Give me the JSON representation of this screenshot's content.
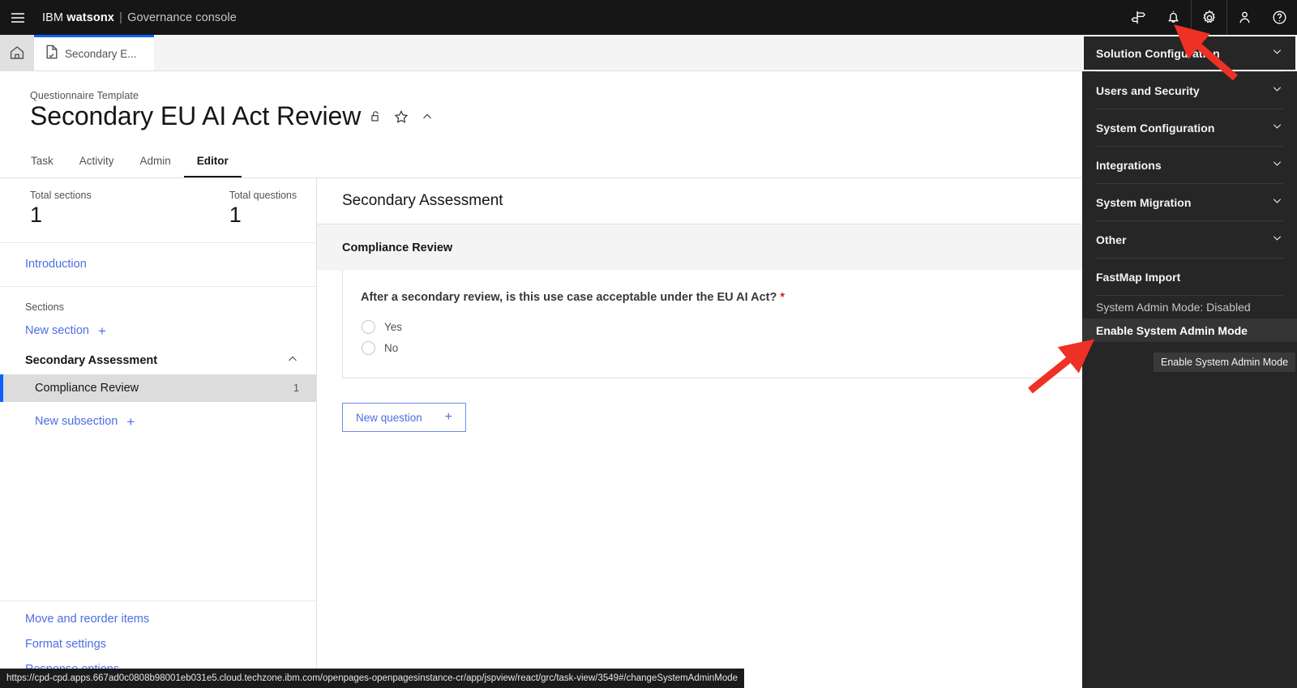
{
  "header": {
    "menu_icon": "hamburger-menu-icon",
    "brand_prefix": "IBM",
    "brand_bold": "watsonx",
    "brand_sep": "|",
    "brand_suffix": "Governance console",
    "icons": [
      {
        "name": "signpost-icon",
        "label": "Signpost"
      },
      {
        "name": "notification-bell-icon",
        "label": "Notifications"
      },
      {
        "name": "gear-icon",
        "label": "Administration"
      },
      {
        "name": "user-avatar-icon",
        "label": "Profile"
      },
      {
        "name": "help-icon",
        "label": "Help"
      }
    ]
  },
  "tabstrip": {
    "home_icon": "home-icon",
    "doc_icon": "document-check-icon",
    "doc_tab_label": "Secondary E..."
  },
  "title_area": {
    "kicker": "Questionnaire Template",
    "title": "Secondary EU AI Act Review",
    "lock_icon": "unlocked-padlock-icon",
    "star_icon": "star-outline-icon",
    "collapse_icon": "chevron-up-icon",
    "tabs": [
      {
        "label": "Task",
        "active": false
      },
      {
        "label": "Activity",
        "active": false
      },
      {
        "label": "Admin",
        "active": false
      },
      {
        "label": "Editor",
        "active": true
      }
    ]
  },
  "left_panel": {
    "stats": [
      {
        "label": "Total sections",
        "value": "1"
      },
      {
        "label": "Total questions",
        "value": "1"
      }
    ],
    "introduction_link": "Introduction",
    "sections_label": "Sections",
    "new_section_link": "New section",
    "new_section_plus": "+",
    "section": {
      "name": "Secondary Assessment",
      "collapse_icon": "chevron-up-icon",
      "subsections": [
        {
          "name": "Compliance Review",
          "count": "1",
          "selected": true
        }
      ],
      "new_subsection_link": "New subsection",
      "new_subsection_plus": "+"
    },
    "bottom_links": [
      "Move and reorder items",
      "Format settings",
      "Response options"
    ]
  },
  "main": {
    "section_title": "Secondary Assessment",
    "subsection_title": "Compliance Review",
    "question": {
      "text": "After a secondary review, is this use case acceptable under the EU AI Act?",
      "required_marker": "*",
      "options": [
        {
          "label": "Yes",
          "selected": false
        },
        {
          "label": "No",
          "selected": false
        }
      ]
    },
    "new_question_label": "New question",
    "new_question_plus": "+"
  },
  "right_panel": {
    "groups": [
      {
        "label": "Solution Configuration",
        "icon": "chevron-down-icon",
        "focused": true
      },
      {
        "label": "Users and Security",
        "icon": "chevron-down-icon",
        "focused": false
      },
      {
        "label": "System Configuration",
        "icon": "chevron-down-icon",
        "focused": false
      },
      {
        "label": "Integrations",
        "icon": "chevron-down-icon",
        "focused": false
      },
      {
        "label": "System Migration",
        "icon": "chevron-down-icon",
        "focused": false
      },
      {
        "label": "Other",
        "icon": "chevron-down-icon",
        "focused": false
      }
    ],
    "fastmap_import": "FastMap Import",
    "admin_mode_status": "System Admin Mode: Disabled",
    "enable_admin_mode": "Enable System Admin Mode",
    "tooltip": "Enable System Admin Mode"
  },
  "status_bar": {
    "url": "https://cpd-cpd.apps.667ad0c0808b98001eb031e5.cloud.techzone.ibm.com/openpages-openpagesinstance-cr/app/jspview/react/grc/task-view/3549#/changeSystemAdminMode"
  },
  "colors": {
    "brand_blue": "#0f62fe",
    "link_blue": "#4c6ee0",
    "dark_header": "#161616",
    "dark_panel": "#262626",
    "required_red": "#da1e28",
    "annotation_red": "#ee3124",
    "selected_row": "#dcdcdc",
    "band_gray": "#f4f4f4"
  },
  "annotations": [
    {
      "name": "arrow-to-gear-icon",
      "color": "#ee3124"
    },
    {
      "name": "arrow-to-enable-system-admin-mode",
      "color": "#ee3124"
    }
  ]
}
